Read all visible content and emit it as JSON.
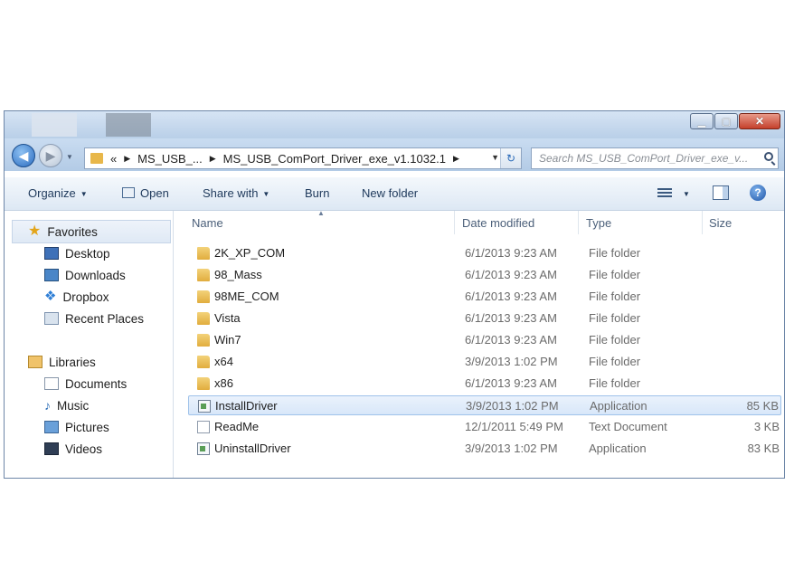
{
  "window": {
    "caption_buttons": [
      "minimize-icon",
      "maximize-icon",
      "close-icon"
    ]
  },
  "address_bar": {
    "overflow": "«",
    "crumbs": [
      "MS_USB_...",
      "MS_USB_ComPort_Driver_exe_v1.1032.1"
    ]
  },
  "search": {
    "placeholder": "Search MS_USB_ComPort_Driver_exe_v..."
  },
  "toolbar": {
    "organize": "Organize",
    "open": "Open",
    "share_with": "Share with",
    "burn": "Burn",
    "new_folder": "New folder"
  },
  "sidebar": {
    "favorites": "Favorites",
    "favorite_items": [
      "Desktop",
      "Downloads",
      "Dropbox",
      "Recent Places"
    ],
    "libraries": "Libraries",
    "library_items": [
      "Documents",
      "Music",
      "Pictures",
      "Videos"
    ]
  },
  "columns": {
    "name": "Name",
    "date": "Date modified",
    "type": "Type",
    "size": "Size"
  },
  "files": [
    {
      "name": "2K_XP_COM",
      "date": "6/1/2013 9:23 AM",
      "type": "File folder",
      "size": "",
      "icon": "folder-icon"
    },
    {
      "name": "98_Mass",
      "date": "6/1/2013 9:23 AM",
      "type": "File folder",
      "size": "",
      "icon": "folder-icon"
    },
    {
      "name": "98ME_COM",
      "date": "6/1/2013 9:23 AM",
      "type": "File folder",
      "size": "",
      "icon": "folder-icon"
    },
    {
      "name": "Vista",
      "date": "6/1/2013 9:23 AM",
      "type": "File folder",
      "size": "",
      "icon": "folder-icon"
    },
    {
      "name": "Win7",
      "date": "6/1/2013 9:23 AM",
      "type": "File folder",
      "size": "",
      "icon": "folder-icon"
    },
    {
      "name": "x64",
      "date": "3/9/2013 1:02 PM",
      "type": "File folder",
      "size": "",
      "icon": "folder-icon"
    },
    {
      "name": "x86",
      "date": "6/1/2013 9:23 AM",
      "type": "File folder",
      "size": "",
      "icon": "folder-icon"
    },
    {
      "name": "InstallDriver",
      "date": "3/9/2013 1:02 PM",
      "type": "Application",
      "size": "85 KB",
      "icon": "application-icon"
    },
    {
      "name": "ReadMe",
      "date": "12/1/2011 5:49 PM",
      "type": "Text Document",
      "size": "3 KB",
      "icon": "text-document-icon"
    },
    {
      "name": "UninstallDriver",
      "date": "3/9/2013 1:02 PM",
      "type": "Application",
      "size": "83 KB",
      "icon": "application-icon"
    }
  ],
  "selected_file": "InstallDriver",
  "colors": {
    "accent": "#2b6cc0",
    "selection": "#d8e7f9",
    "folder": "#e1ad3e"
  }
}
